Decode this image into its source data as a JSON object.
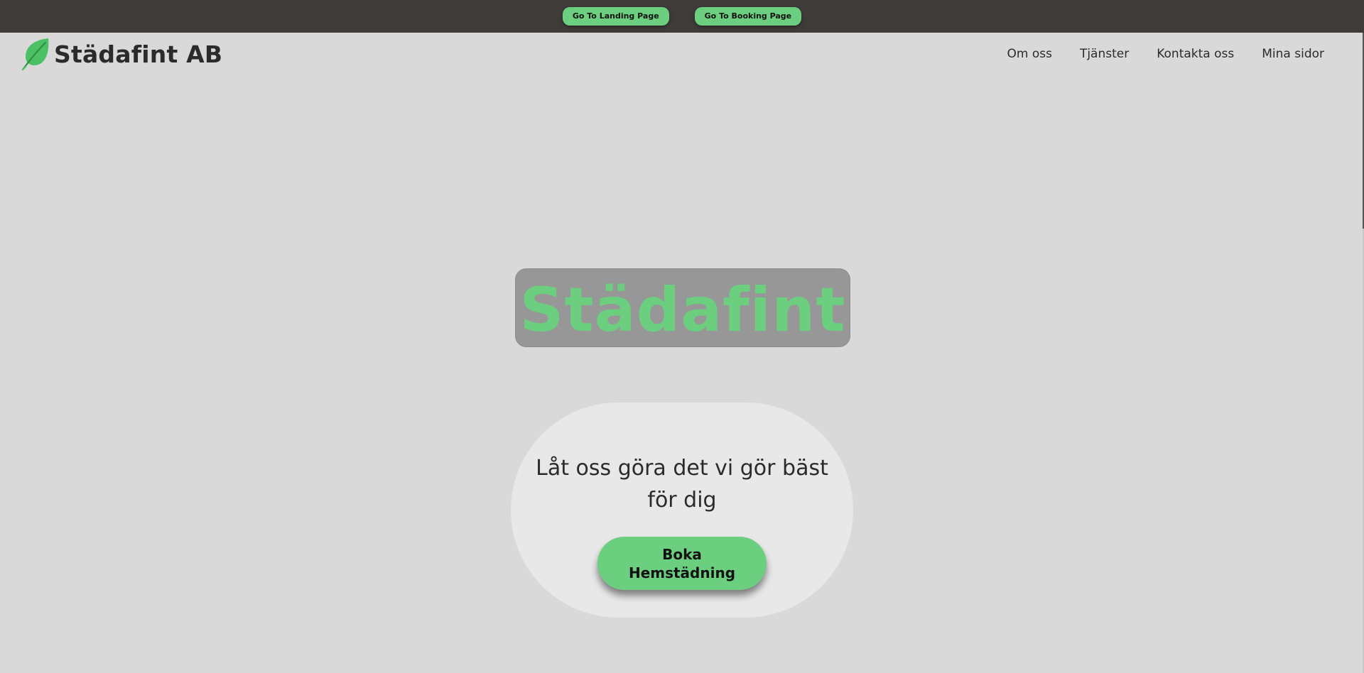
{
  "topbar": {
    "landing_label": "Go To Landing Page",
    "booking_label": "Go To Booking Page"
  },
  "header": {
    "brand": "Städafint AB",
    "logo_icon": "leaf-icon",
    "nav": [
      {
        "label": "Om oss"
      },
      {
        "label": "Tjänster"
      },
      {
        "label": "Kontakta oss"
      },
      {
        "label": "Mina sidor"
      }
    ]
  },
  "hero": {
    "title": "Städafint",
    "tagline_line1": "Låt oss göra det vi gör bäst",
    "tagline_line2": "för dig",
    "cta_line1": "Boka",
    "cta_line2": "Hemstädning"
  },
  "colors": {
    "accent_green": "#6ccf7f",
    "topbar_bg": "#3f3b38",
    "page_bg": "#d9d9d9",
    "title_box_bg": "#979797",
    "card_bg": "#e8e8e8",
    "text_dark": "#2b2b2b"
  }
}
